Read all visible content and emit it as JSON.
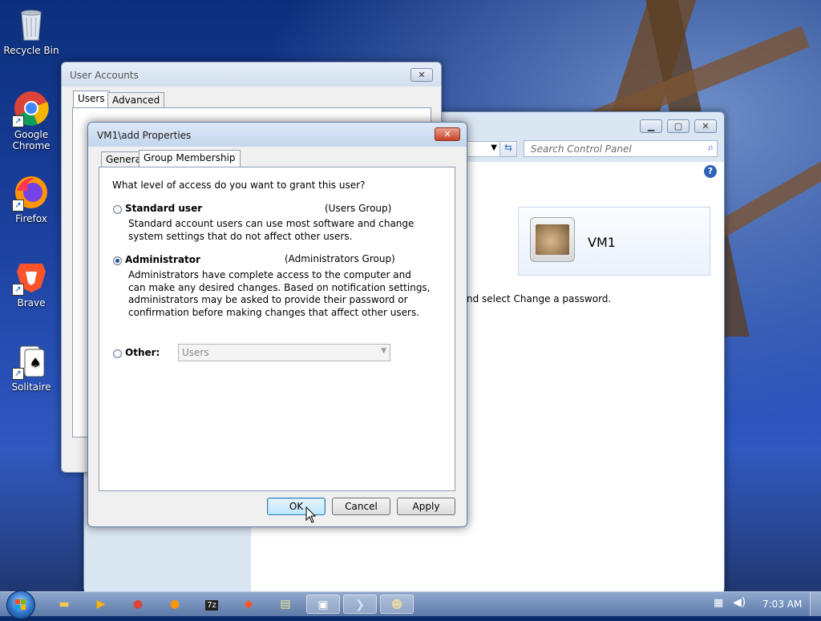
{
  "desktop": {
    "icons": [
      {
        "label": "Recycle Bin",
        "icon": "recycle-bin-icon"
      },
      {
        "label": "Google Chrome",
        "icon": "chrome-icon"
      },
      {
        "label": "Firefox",
        "icon": "firefox-icon"
      },
      {
        "label": "Brave",
        "icon": "brave-icon"
      },
      {
        "label": "Solitaire",
        "icon": "solitaire-icon"
      }
    ]
  },
  "user_accounts": {
    "title": "User Accounts",
    "tabs": [
      "Users",
      "Advanced"
    ],
    "close_label": "✕"
  },
  "control_panel": {
    "search_placeholder": "Search Control Panel",
    "user_name": "VM1",
    "instruction_fragment": "nd select Change a password.",
    "help_label": "?"
  },
  "dialog": {
    "title": "VM1\\add Properties",
    "tabs": [
      "General",
      "Group Membership"
    ],
    "question": "What level of access do you want to grant this user?",
    "options": [
      {
        "label": "Standard user",
        "group": "(Users Group)",
        "selected": false,
        "description": [
          "Standard account users can use most software and change",
          "system settings that do not affect other users."
        ]
      },
      {
        "label": "Administrator",
        "group": "(Administrators Group)",
        "selected": true,
        "description": [
          "Administrators have complete access to the computer and",
          "can make any desired changes. Based on notification settings,",
          "administrators may be asked to provide their password or",
          "confirmation before making changes that affect other users."
        ]
      },
      {
        "label": "Other:",
        "selected": false
      }
    ],
    "other_select_value": "Users",
    "buttons": {
      "ok": "OK",
      "cancel": "Cancel",
      "apply": "Apply"
    }
  },
  "taskbar": {
    "clock": "7:03 AM",
    "items": [
      "explorer",
      "media-player",
      "chrome",
      "firefox",
      "7zip",
      "brave",
      "notepad",
      "remote-desktop",
      "powershell",
      "user-accounts"
    ]
  }
}
